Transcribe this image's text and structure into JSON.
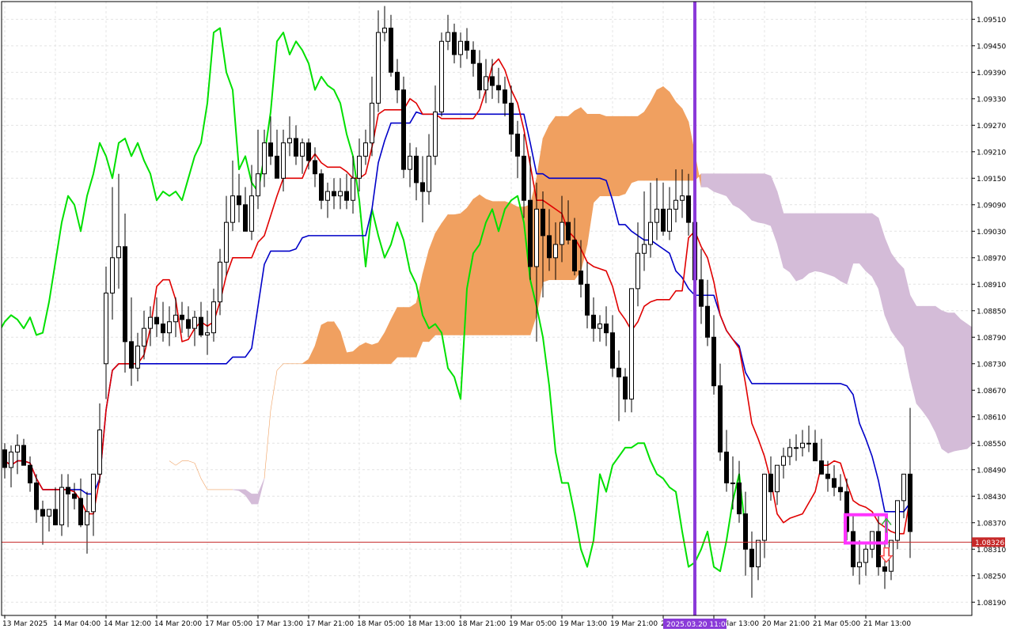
{
  "chart_data": {
    "type": "candlestick",
    "instrument_note": "",
    "y_axis": {
      "range": [
        1.0816,
        1.0955
      ],
      "tick_labels": [
        "1.09510",
        "1.09450",
        "1.09390",
        "1.09330",
        "1.09270",
        "1.09210",
        "1.09150",
        "1.09090",
        "1.09030",
        "1.08970",
        "1.08910",
        "1.08850",
        "1.08790",
        "1.08730",
        "1.08670",
        "1.08610",
        "1.08550",
        "1.08490",
        "1.08430",
        "1.08370",
        "1.08310",
        "1.08250",
        "1.08190"
      ],
      "tick_values": [
        1.0951,
        1.0945,
        1.0939,
        1.0933,
        1.0927,
        1.0921,
        1.0915,
        1.0909,
        1.0903,
        1.0897,
        1.0891,
        1.0885,
        1.0879,
        1.0873,
        1.0867,
        1.0861,
        1.0855,
        1.0849,
        1.0843,
        1.0837,
        1.0831,
        1.0825,
        1.0819
      ],
      "position": "right"
    },
    "x_axis": {
      "tick_labels": [
        "13 Mar 2025",
        "14 Mar 04:00",
        "14 Mar 12:00",
        "14 Mar 20:00",
        "17 Mar 05:00",
        "17 Mar 13:00",
        "17 Mar 21:00",
        "18 Mar 05:00",
        "18 Mar 13:00",
        "18 Mar 21:00",
        "19 Mar 05:00",
        "19 Mar 13:00",
        "19 Mar 21:00",
        "20",
        "20 Mar 13:00",
        "20 Mar 21:00",
        "21 Mar 05:00",
        "21 Mar 13:00"
      ],
      "tick_bar_index": [
        0,
        8,
        16,
        24,
        32,
        40,
        48,
        56,
        64,
        72,
        80,
        88,
        96,
        104,
        112,
        120,
        128,
        136
      ]
    },
    "grid": true,
    "current_price": {
      "label": "1.08326",
      "value": 1.08326,
      "color": "#c62828"
    },
    "vertical_marker": {
      "label": "2025.03.20 11:00",
      "bar_index": 109,
      "color": "#8a3ad8"
    },
    "signal_box": {
      "bar_start": 133,
      "bar_end": 139,
      "price_low": 1.08324,
      "price_high": 1.08388,
      "color": "#ff33ff"
    },
    "arrows": [
      {
        "direction": "up",
        "bar_index": 139,
        "price": 1.08365,
        "color": "#3cb043"
      },
      {
        "direction": "down",
        "bar_index": 139,
        "price": 1.08295,
        "color": "#ff4d4d"
      }
    ],
    "candles": {
      "open": [
        1.08535,
        1.08495,
        1.0853,
        1.08545,
        1.085,
        1.0846,
        1.084,
        1.08385,
        1.084,
        1.08365,
        1.0845,
        1.08435,
        1.08425,
        1.08365,
        1.08395,
        1.0848,
        1.0873,
        1.0889,
        1.0897,
        1.08995,
        1.0878,
        1.0872,
        1.0877,
        1.0881,
        1.08835,
        1.0882,
        1.088,
        1.08825,
        1.0884,
        1.0883,
        1.0881,
        1.08835,
        1.08795,
        1.088,
        1.0887,
        1.0896,
        1.0905,
        1.0911,
        1.0909,
        1.0903,
        1.0911,
        1.0916,
        1.0923,
        1.092,
        1.0915,
        1.0923,
        1.0924,
        1.092,
        1.0923,
        1.0919,
        1.0916,
        1.091,
        1.0912,
        1.0911,
        1.0912,
        1.091,
        1.0915,
        1.092,
        1.0923,
        1.0932,
        1.0948,
        1.0949,
        1.0939,
        1.0935,
        1.0917,
        1.092,
        1.0914,
        1.0912,
        1.092,
        1.093,
        1.0946,
        1.0948,
        1.0943,
        1.0946,
        1.0944,
        1.0941,
        1.0935,
        1.0938,
        1.0936,
        1.0935,
        1.0932,
        1.0925,
        1.092,
        1.091,
        1.0895,
        1.0908,
        1.0902,
        1.0897,
        1.09,
        1.0905,
        1.0901,
        1.0894,
        1.0891,
        1.0884,
        1.0881,
        1.0882,
        1.088,
        1.0872,
        1.087,
        1.0865,
        1.089,
        1.0898,
        1.09,
        1.0905,
        1.0908,
        1.0903,
        1.0908,
        1.091,
        1.0911,
        1.0905,
        1.0892,
        1.0886,
        1.0879,
        1.0868,
        1.0853,
        1.0846,
        1.0846,
        1.0839,
        1.0831,
        1.0827,
        1.0833,
        1.0848,
        1.0844,
        1.085,
        1.0852,
        1.0854,
        1.0854,
        1.0855,
        1.0855,
        1.0851,
        1.0848,
        1.0847,
        1.0845,
        1.0844,
        1.0835,
        1.0827,
        1.0828,
        1.0831,
        1.0835,
        1.0827,
        1.0826,
        1.0833,
        1.0842,
        1.0848
      ],
      "high": [
        1.0855,
        1.08545,
        1.0857,
        1.0856,
        1.0852,
        1.0848,
        1.0842,
        1.084,
        1.0845,
        1.0848,
        1.0848,
        1.0846,
        1.0847,
        1.0844,
        1.0846,
        1.0864,
        1.0895,
        1.0913,
        1.0916,
        1.0907,
        1.0888,
        1.088,
        1.0885,
        1.0886,
        1.0888,
        1.0887,
        1.0886,
        1.0888,
        1.0887,
        1.0886,
        1.0885,
        1.0887,
        1.0885,
        1.089,
        1.0899,
        1.0911,
        1.0919,
        1.0916,
        1.0913,
        1.0918,
        1.0926,
        1.0926,
        1.0929,
        1.0926,
        1.0926,
        1.0929,
        1.0927,
        1.0924,
        1.0924,
        1.0922,
        1.0917,
        1.0914,
        1.0915,
        1.0915,
        1.0916,
        1.092,
        1.0924,
        1.0926,
        1.0938,
        1.0953,
        1.0954,
        1.0952,
        1.0942,
        1.0938,
        1.0923,
        1.0922,
        1.092,
        1.0925,
        1.0936,
        1.0948,
        1.0952,
        1.095,
        1.0948,
        1.0949,
        1.0946,
        1.0944,
        1.0942,
        1.0942,
        1.094,
        1.0938,
        1.0936,
        1.0928,
        1.0925,
        1.092,
        1.0914,
        1.0912,
        1.0908,
        1.0905,
        1.0911,
        1.091,
        1.0906,
        1.0901,
        1.0896,
        1.0888,
        1.0884,
        1.0886,
        1.0884,
        1.0876,
        1.0872,
        1.087,
        1.0905,
        1.0912,
        1.0914,
        1.0915,
        1.0914,
        1.0913,
        1.0917,
        1.0917,
        1.0916,
        1.0912,
        1.0899,
        1.0892,
        1.0884,
        1.0873,
        1.0858,
        1.0852,
        1.0851,
        1.0844,
        1.0835,
        1.0831,
        1.0838,
        1.0852,
        1.0849,
        1.0854,
        1.0856,
        1.0857,
        1.0858,
        1.0859,
        1.0858,
        1.0856,
        1.0851,
        1.085,
        1.0848,
        1.0847,
        1.0839,
        1.0833,
        1.0832,
        1.0835,
        1.0839,
        1.0833,
        1.0832,
        1.0837,
        1.0847,
        1.0863
      ],
      "low": [
        1.0847,
        1.0845,
        1.0848,
        1.085,
        1.0844,
        1.0837,
        1.0832,
        1.0835,
        1.0837,
        1.0834,
        1.0836,
        1.084,
        1.0836,
        1.083,
        1.0834,
        1.0846,
        1.0865,
        1.0883,
        1.089,
        1.0871,
        1.0868,
        1.0869,
        1.0874,
        1.0877,
        1.0879,
        1.0878,
        1.0877,
        1.0879,
        1.088,
        1.0879,
        1.0877,
        1.0879,
        1.0875,
        1.0878,
        1.0884,
        1.0893,
        1.0903,
        1.0905,
        1.0903,
        1.0901,
        1.0908,
        1.0913,
        1.0918,
        1.0915,
        1.0912,
        1.092,
        1.0918,
        1.0916,
        1.0917,
        1.0913,
        1.0908,
        1.0906,
        1.0908,
        1.0908,
        1.0908,
        1.0907,
        1.0912,
        1.0918,
        1.092,
        1.093,
        1.0946,
        1.0938,
        1.0932,
        1.0915,
        1.0913,
        1.091,
        1.0905,
        1.0909,
        1.0918,
        1.0929,
        1.0944,
        1.0941,
        1.094,
        1.0942,
        1.0938,
        1.0933,
        1.0932,
        1.0933,
        1.0932,
        1.0929,
        1.0921,
        1.0915,
        1.0906,
        1.0892,
        1.0878,
        1.0888,
        1.0894,
        1.0892,
        1.0896,
        1.09,
        1.0893,
        1.0888,
        1.0881,
        1.0878,
        1.0878,
        1.0877,
        1.087,
        1.086,
        1.0862,
        1.0862,
        1.0886,
        1.0894,
        1.0897,
        1.0901,
        1.0902,
        1.0901,
        1.0905,
        1.0906,
        1.0902,
        1.0889,
        1.0882,
        1.0877,
        1.0866,
        1.0851,
        1.0844,
        1.084,
        1.0837,
        1.0825,
        1.082,
        1.0824,
        1.0829,
        1.0842,
        1.0841,
        1.0847,
        1.085,
        1.0851,
        1.0852,
        1.0853,
        1.0851,
        1.0848,
        1.0844,
        1.0843,
        1.0842,
        1.0833,
        1.0825,
        1.0823,
        1.0825,
        1.0829,
        1.0825,
        1.0822,
        1.0824,
        1.0831,
        1.0838,
        1.0829
      ],
      "close": [
        1.08495,
        1.0853,
        1.08545,
        1.085,
        1.0846,
        1.084,
        1.08385,
        1.084,
        1.08365,
        1.0845,
        1.08435,
        1.08425,
        1.08365,
        1.08395,
        1.0848,
        1.0858,
        1.0889,
        1.0897,
        1.08995,
        1.0878,
        1.0872,
        1.0877,
        1.0881,
        1.08835,
        1.0882,
        1.088,
        1.08825,
        1.0884,
        1.0883,
        1.0881,
        1.08835,
        1.08795,
        1.088,
        1.0887,
        1.0896,
        1.0905,
        1.0911,
        1.0909,
        1.0903,
        1.0911,
        1.0916,
        1.0923,
        1.092,
        1.0915,
        1.0923,
        1.0924,
        1.092,
        1.0923,
        1.0919,
        1.0916,
        1.091,
        1.0912,
        1.0911,
        1.0912,
        1.091,
        1.0915,
        1.092,
        1.0923,
        1.0932,
        1.0948,
        1.0949,
        1.0939,
        1.0935,
        1.0917,
        1.092,
        1.0914,
        1.0912,
        1.092,
        1.093,
        1.0946,
        1.0948,
        1.0943,
        1.0946,
        1.0944,
        1.0941,
        1.0935,
        1.0938,
        1.0936,
        1.0935,
        1.0932,
        1.0925,
        1.092,
        1.091,
        1.0895,
        1.0908,
        1.0902,
        1.0897,
        1.09,
        1.0905,
        1.0901,
        1.0894,
        1.0891,
        1.0884,
        1.0881,
        1.0882,
        1.088,
        1.0872,
        1.087,
        1.0865,
        1.089,
        1.0898,
        1.09,
        1.0905,
        1.0908,
        1.0903,
        1.0908,
        1.091,
        1.0911,
        1.0905,
        1.0892,
        1.0886,
        1.0879,
        1.0868,
        1.0853,
        1.0846,
        1.0846,
        1.0839,
        1.0831,
        1.0827,
        1.0833,
        1.0848,
        1.0844,
        1.085,
        1.0852,
        1.0854,
        1.0854,
        1.0855,
        1.0855,
        1.0851,
        1.0848,
        1.0847,
        1.0845,
        1.0844,
        1.0835,
        1.0827,
        1.0828,
        1.0831,
        1.0835,
        1.0827,
        1.0826,
        1.0833,
        1.0842,
        1.0848,
        1.0835
      ]
    },
    "indicators": {
      "tenkan_color": "#e00000",
      "kijun_color": "#0000c8",
      "chikou_color": "#00e000",
      "cloud_bull_color": "#f0a060",
      "cloud_bear_color": "#d4bcd8"
    }
  }
}
